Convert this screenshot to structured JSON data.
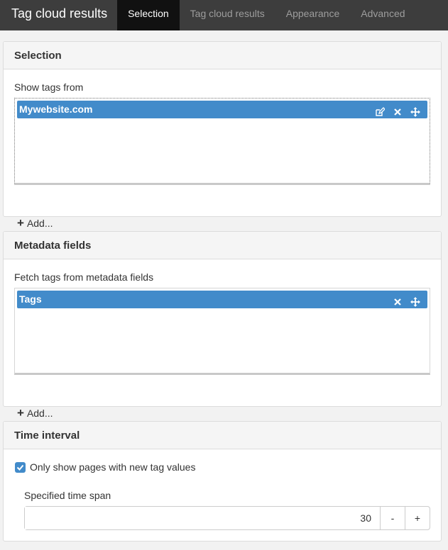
{
  "header": {
    "title": "Tag cloud results",
    "tabs": [
      {
        "label": "Selection",
        "active": true
      },
      {
        "label": "Tag cloud results",
        "active": false
      },
      {
        "label": "Appearance",
        "active": false
      },
      {
        "label": "Advanced",
        "active": false
      }
    ]
  },
  "selection": {
    "title": "Selection",
    "label": "Show tags from",
    "items": [
      {
        "label": "Mywebsite.com",
        "icons": [
          "edit-icon",
          "close-icon",
          "move-icon"
        ]
      }
    ],
    "add_label": "Add..."
  },
  "metadata": {
    "title": "Metadata fields",
    "label": "Fetch tags from metadata fields",
    "items": [
      {
        "label": "Tags",
        "icons": [
          "close-icon",
          "move-icon"
        ]
      }
    ],
    "add_label": "Add..."
  },
  "time_interval": {
    "title": "Time interval",
    "checkbox_label": "Only show pages with new tag values",
    "checkbox_checked": true,
    "span_label": "Specified time span",
    "span_value": "30",
    "decrement_label": "-",
    "increment_label": "+"
  },
  "colors": {
    "accent": "#428bca",
    "topbar": "#3d3d3d",
    "active_tab": "#111111"
  }
}
